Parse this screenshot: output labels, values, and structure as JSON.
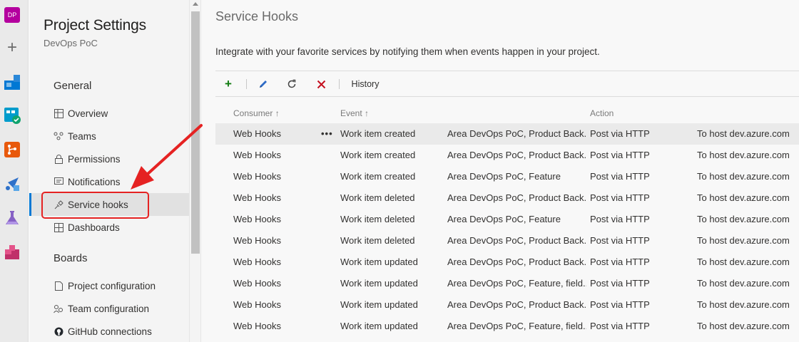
{
  "rail": {
    "org_initials": "DP",
    "icons": [
      "plus-icon",
      "overview-icon",
      "boards-icon",
      "repos-icon",
      "pipelines-icon",
      "test-plans-icon",
      "artifacts-icon"
    ]
  },
  "sidebar": {
    "title": "Project Settings",
    "project": "DevOps PoC",
    "sections": [
      {
        "heading": "General",
        "items": [
          {
            "label": "Overview",
            "icon": "overview-icon"
          },
          {
            "label": "Teams",
            "icon": "teams-icon"
          },
          {
            "label": "Permissions",
            "icon": "lock-icon"
          },
          {
            "label": "Notifications",
            "icon": "notifications-icon"
          },
          {
            "label": "Service hooks",
            "icon": "service-hooks-icon",
            "selected": true
          },
          {
            "label": "Dashboards",
            "icon": "dashboards-icon"
          }
        ]
      },
      {
        "heading": "Boards",
        "items": [
          {
            "label": "Project configuration",
            "icon": "document-icon"
          },
          {
            "label": "Team configuration",
            "icon": "team-config-icon"
          },
          {
            "label": "GitHub connections",
            "icon": "github-icon"
          }
        ]
      }
    ]
  },
  "main": {
    "title": "Service Hooks",
    "description": "Integrate with your favorite services by notifying them when events happen in your project.",
    "toolbar": {
      "add": "+",
      "history": "History"
    },
    "columns": {
      "consumer": "Consumer",
      "event": "Event",
      "action": "Action"
    },
    "rows": [
      {
        "consumer": "Web Hooks",
        "event": "Work item created",
        "filter": "Area DevOps PoC, Product Back...",
        "action": "Post via HTTP",
        "target": "To host dev.azure.com"
      },
      {
        "consumer": "Web Hooks",
        "event": "Work item created",
        "filter": "Area DevOps PoC, Product Back...",
        "action": "Post via HTTP",
        "target": "To host dev.azure.com"
      },
      {
        "consumer": "Web Hooks",
        "event": "Work item created",
        "filter": "Area DevOps PoC, Feature",
        "action": "Post via HTTP",
        "target": "To host dev.azure.com"
      },
      {
        "consumer": "Web Hooks",
        "event": "Work item deleted",
        "filter": "Area DevOps PoC, Product Back...",
        "action": "Post via HTTP",
        "target": "To host dev.azure.com"
      },
      {
        "consumer": "Web Hooks",
        "event": "Work item deleted",
        "filter": "Area DevOps PoC, Feature",
        "action": "Post via HTTP",
        "target": "To host dev.azure.com"
      },
      {
        "consumer": "Web Hooks",
        "event": "Work item deleted",
        "filter": "Area DevOps PoC, Product Back...",
        "action": "Post via HTTP",
        "target": "To host dev.azure.com"
      },
      {
        "consumer": "Web Hooks",
        "event": "Work item updated",
        "filter": "Area DevOps PoC, Product Back...",
        "action": "Post via HTTP",
        "target": "To host dev.azure.com"
      },
      {
        "consumer": "Web Hooks",
        "event": "Work item updated",
        "filter": "Area DevOps PoC, Feature, field...",
        "action": "Post via HTTP",
        "target": "To host dev.azure.com"
      },
      {
        "consumer": "Web Hooks",
        "event": "Work item updated",
        "filter": "Area DevOps PoC, Product Back...",
        "action": "Post via HTTP",
        "target": "To host dev.azure.com"
      },
      {
        "consumer": "Web Hooks",
        "event": "Work item updated",
        "filter": "Area DevOps PoC, Feature, field...",
        "action": "Post via HTTP",
        "target": "To host dev.azure.com"
      }
    ],
    "row_more": "•••"
  },
  "colors": {
    "accent": "#0078d4",
    "annotation_red": "#e52222",
    "org_badge": "#b4009e",
    "add_green": "#107c10",
    "delete_red": "#c50f1f"
  }
}
